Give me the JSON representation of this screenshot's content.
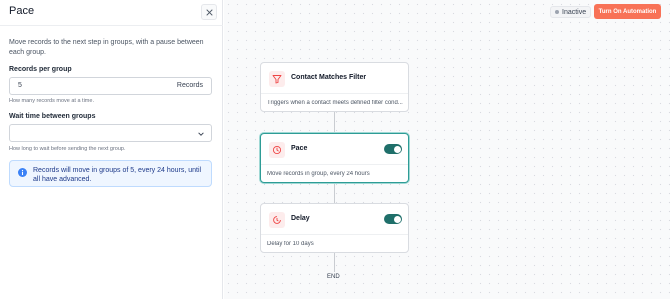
{
  "panel": {
    "title": "Pace",
    "description": "Move records to the next step in groups, with a pause between each group.",
    "records_label": "Records per group",
    "records_value": "5",
    "records_suffix": "Records",
    "records_help": "How many records move at a time.",
    "wait_label": "Wait time between groups",
    "wait_value": "",
    "wait_help": "How long to wait before sending the next group.",
    "info_text": "Records will move in groups of 5, every 24 hours, until all have advanced."
  },
  "toolbar": {
    "status": "Inactive",
    "automation_button": "Turn On Automation"
  },
  "nodes": [
    {
      "title": "Contact Matches Filter",
      "description": "Triggers when a contact meets defined filter cond...",
      "icon": "filter-icon",
      "toggle": null
    },
    {
      "title": "Pace",
      "description": "Move records in group, every 24 hours",
      "icon": "pace-icon",
      "toggle": true
    },
    {
      "title": "Delay",
      "description": "Delay for 10 days",
      "icon": "delay-icon",
      "toggle": true
    }
  ],
  "end_label": "END",
  "colors": {
    "accent": "#f87257",
    "toggle_on": "#1f6f6a",
    "selected_border": "#2e9c96",
    "info_bg": "#eff6ff"
  }
}
